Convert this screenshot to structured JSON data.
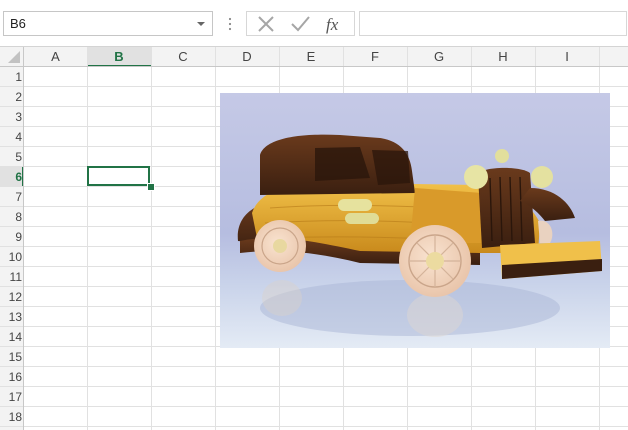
{
  "formula_bar": {
    "name_box_value": "B6",
    "fx_label": "fx",
    "formula_value": ""
  },
  "columns": [
    "A",
    "B",
    "C",
    "D",
    "E",
    "F",
    "G",
    "H",
    "I"
  ],
  "rows": [
    "1",
    "2",
    "3",
    "4",
    "5",
    "6",
    "7",
    "8",
    "9",
    "10",
    "11",
    "12",
    "13",
    "14",
    "15",
    "16",
    "17",
    "18"
  ],
  "active_cell": {
    "column": "B",
    "row": "6"
  },
  "picture": {
    "subject": "wooden toy car photo"
  },
  "colors": {
    "accent": "#217346",
    "grid_line": "#e1e1e1",
    "header_bg": "#f3f3f3"
  }
}
